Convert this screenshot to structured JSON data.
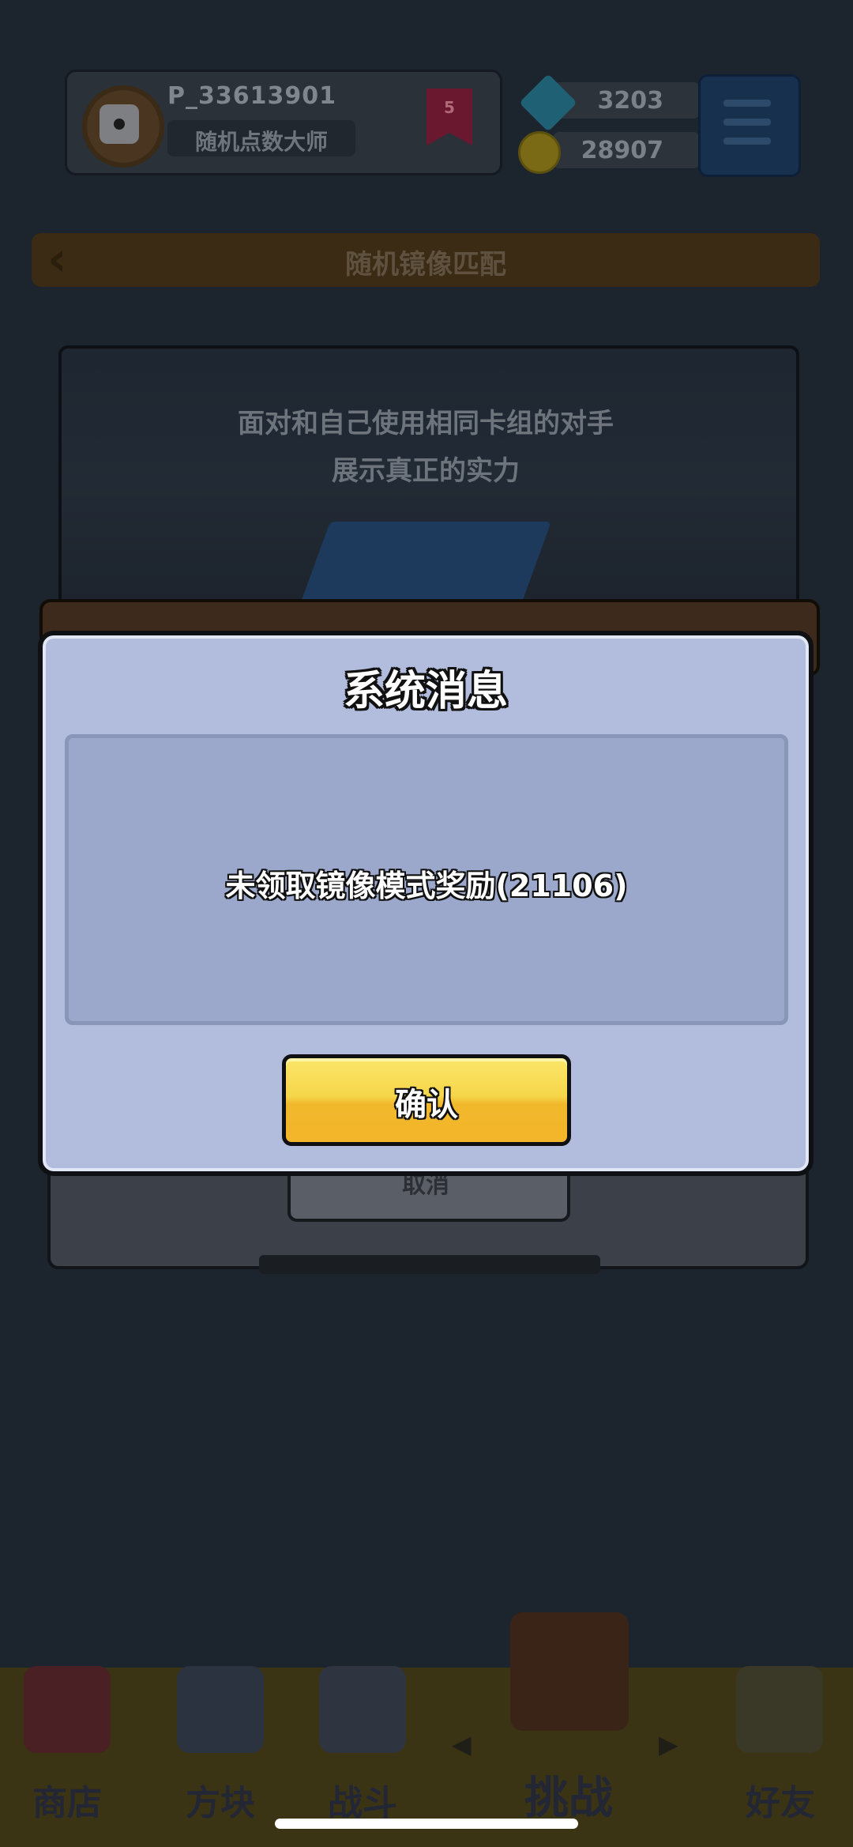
{
  "profile": {
    "player_name": "P_33613901",
    "player_title": "随机点数大师",
    "rank_badge": "5"
  },
  "currency": {
    "gems": "3203",
    "coins": "28907"
  },
  "header": {
    "title": "随机镜像匹配"
  },
  "banner": {
    "line1": "面对和自己使用相同卡组的对手",
    "line2": "展示真正的实力"
  },
  "background_button": {
    "label": "取消"
  },
  "dialog": {
    "title": "系统消息",
    "message": "未领取镜像模式奖励(21106)",
    "confirm_label": "确认"
  },
  "bottom_nav": {
    "items": [
      {
        "label": "商店",
        "icon": "shop-icon"
      },
      {
        "label": "方块",
        "icon": "dice-block-icon"
      },
      {
        "label": "战斗",
        "icon": "battle-icon"
      },
      {
        "label": "挑战",
        "icon": "challenge-icon",
        "active": true
      },
      {
        "label": "好友",
        "icon": "friends-icon"
      }
    ]
  },
  "colors": {
    "dialog_bg": "#b2bcdd",
    "dialog_body": "#9ba8cb",
    "confirm_yellow": "#f6d64a",
    "nav_bg": "#3a3314"
  }
}
